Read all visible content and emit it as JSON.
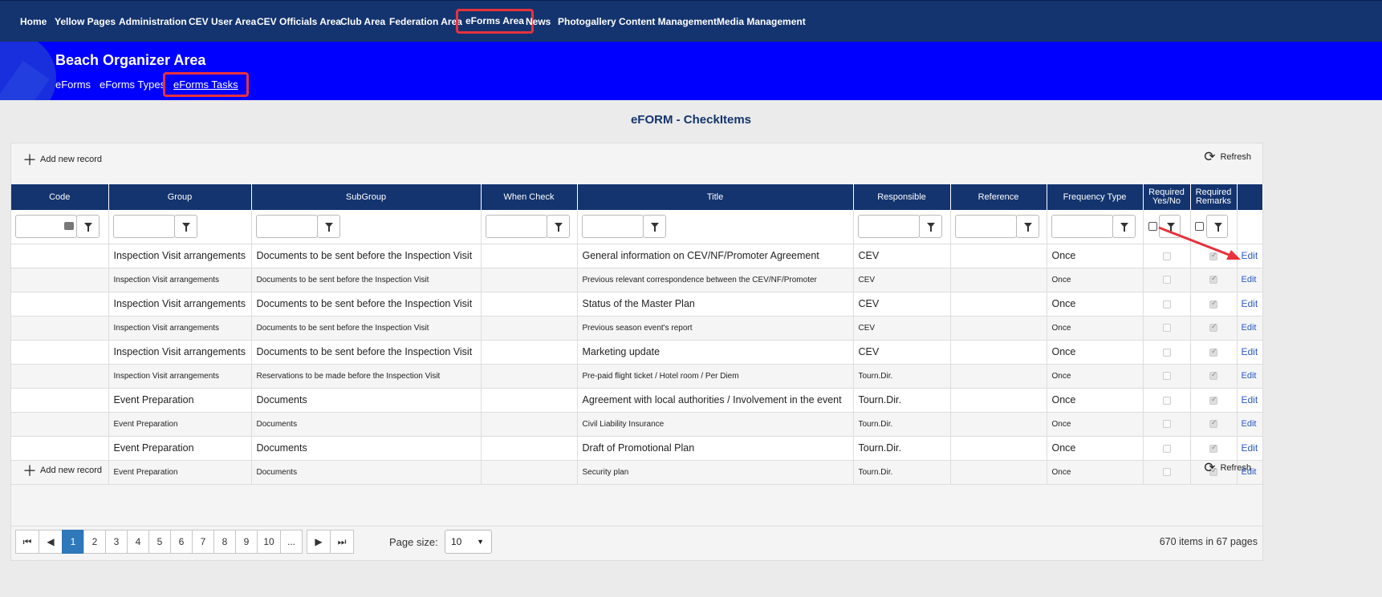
{
  "topnav": {
    "items": [
      "Home",
      "Yellow Pages",
      "Administration",
      "CEV User Area",
      "CEV Officials Area",
      "Club Area",
      "Federation Area",
      "eForms Area",
      "News",
      "Photogallery",
      "Content Management",
      "Media Management"
    ],
    "active_index": 7
  },
  "band": {
    "title": "Beach Organizer Area",
    "subnav": [
      "eForms",
      "eForms Types",
      "eForms Tasks"
    ],
    "active_index": 2
  },
  "page_title": "eFORM - CheckItems",
  "toolbar": {
    "add_label": "Add new record",
    "refresh_label": "Refresh"
  },
  "columns": {
    "code": "Code",
    "group": "Group",
    "subgroup": "SubGroup",
    "when_check": "When Check",
    "title": "Title",
    "responsible": "Responsible",
    "reference": "Reference",
    "frequency": "Frequency Type",
    "required_yesno": "Required Yes/No",
    "required_remarks": "Required Remarks"
  },
  "rows": [
    {
      "code": "",
      "group": "Inspection Visit arrangements",
      "subgroup": "Documents to be sent before the Inspection Visit",
      "when": "",
      "title": "General information on CEV/NF/Promoter Agreement",
      "responsible": "CEV",
      "reference": "",
      "frequency": "Once",
      "yesno": false,
      "remarks": true,
      "edit": "Edit"
    },
    {
      "code": "",
      "group": "Inspection Visit arrangements",
      "subgroup": "Documents to be sent before the Inspection Visit",
      "when": "",
      "title": "Previous relevant correspondence between the CEV/NF/Promoter",
      "responsible": "CEV",
      "reference": "",
      "frequency": "Once",
      "yesno": false,
      "remarks": true,
      "edit": "Edit"
    },
    {
      "code": "",
      "group": "Inspection Visit arrangements",
      "subgroup": "Documents to be sent before the Inspection Visit",
      "when": "",
      "title": "Status of the Master Plan",
      "responsible": "CEV",
      "reference": "",
      "frequency": "Once",
      "yesno": false,
      "remarks": true,
      "edit": "Edit"
    },
    {
      "code": "",
      "group": "Inspection Visit arrangements",
      "subgroup": "Documents to be sent before the Inspection Visit",
      "when": "",
      "title": "Previous season event's report",
      "responsible": "CEV",
      "reference": "",
      "frequency": "Once",
      "yesno": false,
      "remarks": true,
      "edit": "Edit"
    },
    {
      "code": "",
      "group": "Inspection Visit arrangements",
      "subgroup": "Documents to be sent before the Inspection Visit",
      "when": "",
      "title": "Marketing update",
      "responsible": "CEV",
      "reference": "",
      "frequency": "Once",
      "yesno": false,
      "remarks": true,
      "edit": "Edit"
    },
    {
      "code": "",
      "group": "Inspection Visit arrangements",
      "subgroup": "Reservations to be made before the Inspection Visit",
      "when": "",
      "title": "Pre-paid flight ticket / Hotel room / Per Diem",
      "responsible": "Tourn.Dir.",
      "reference": "",
      "frequency": "Once",
      "yesno": false,
      "remarks": true,
      "edit": "Edit"
    },
    {
      "code": "",
      "group": "Event Preparation",
      "subgroup": "Documents",
      "when": "",
      "title": "Agreement with local authorities / Involvement in the event",
      "responsible": "Tourn.Dir.",
      "reference": "",
      "frequency": "Once",
      "yesno": false,
      "remarks": true,
      "edit": "Edit"
    },
    {
      "code": "",
      "group": "Event Preparation",
      "subgroup": "Documents",
      "when": "",
      "title": "Civil Liability Insurance",
      "responsible": "Tourn.Dir.",
      "reference": "",
      "frequency": "Once",
      "yesno": false,
      "remarks": true,
      "edit": "Edit"
    },
    {
      "code": "",
      "group": "Event Preparation",
      "subgroup": "Documents",
      "when": "",
      "title": "Draft of Promotional Plan",
      "responsible": "Tourn.Dir.",
      "reference": "",
      "frequency": "Once",
      "yesno": false,
      "remarks": true,
      "edit": "Edit"
    },
    {
      "code": "",
      "group": "Event Preparation",
      "subgroup": "Documents",
      "when": "",
      "title": "Security plan",
      "responsible": "Tourn.Dir.",
      "reference": "",
      "frequency": "Once",
      "yesno": false,
      "remarks": true,
      "edit": "Edit"
    }
  ],
  "pager": {
    "pages": [
      "1",
      "2",
      "3",
      "4",
      "5",
      "6",
      "7",
      "8",
      "9",
      "10",
      "..."
    ],
    "current": "1",
    "page_size_label": "Page size:",
    "page_size": "10",
    "items_info": "670 items in 67 pages"
  },
  "colors": {
    "nav": "#14346f",
    "band": "#0000ff",
    "highlight": "#e8323c",
    "pager_active": "#2f78ba"
  }
}
